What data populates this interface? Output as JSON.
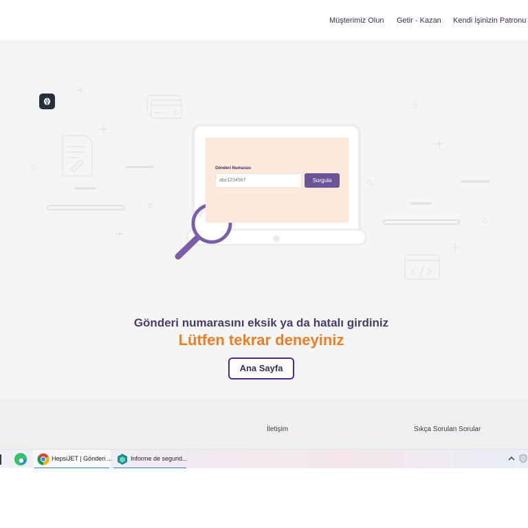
{
  "header": {
    "nav": [
      {
        "label": "Müşterimiz Olun"
      },
      {
        "label": "Getir - Kazan"
      },
      {
        "label": "Kendi İşinizin Patronu O"
      }
    ]
  },
  "form": {
    "label": "Gönderi Numarası",
    "placeholder": "abc1234567",
    "button_label": "Sorgula"
  },
  "error": {
    "title": "Gönderi numarasını eksik ya da hatalı girdiniz",
    "subtitle": "Lütfen tekrar deneyiniz",
    "home_button": "Ana Sayfa"
  },
  "footer": {
    "links": [
      {
        "label": "İletişim"
      },
      {
        "label": "Sıkça Sorulan Sorular"
      }
    ]
  },
  "taskbar": {
    "tasks": [
      {
        "label": "HepsiJET | Gönderi ..."
      },
      {
        "label": "Informe de segurid..."
      }
    ]
  },
  "colors": {
    "brand_purple": "#6b5498",
    "accent_orange": "#ef7d24",
    "title_text": "#4a3b68",
    "background": "#f5f5f6"
  },
  "icons": [
    "brain-icon",
    "magnifier-icon",
    "edge-icon",
    "chrome-icon",
    "security-app-icon",
    "chevron-up-icon",
    "shield-icon"
  ]
}
